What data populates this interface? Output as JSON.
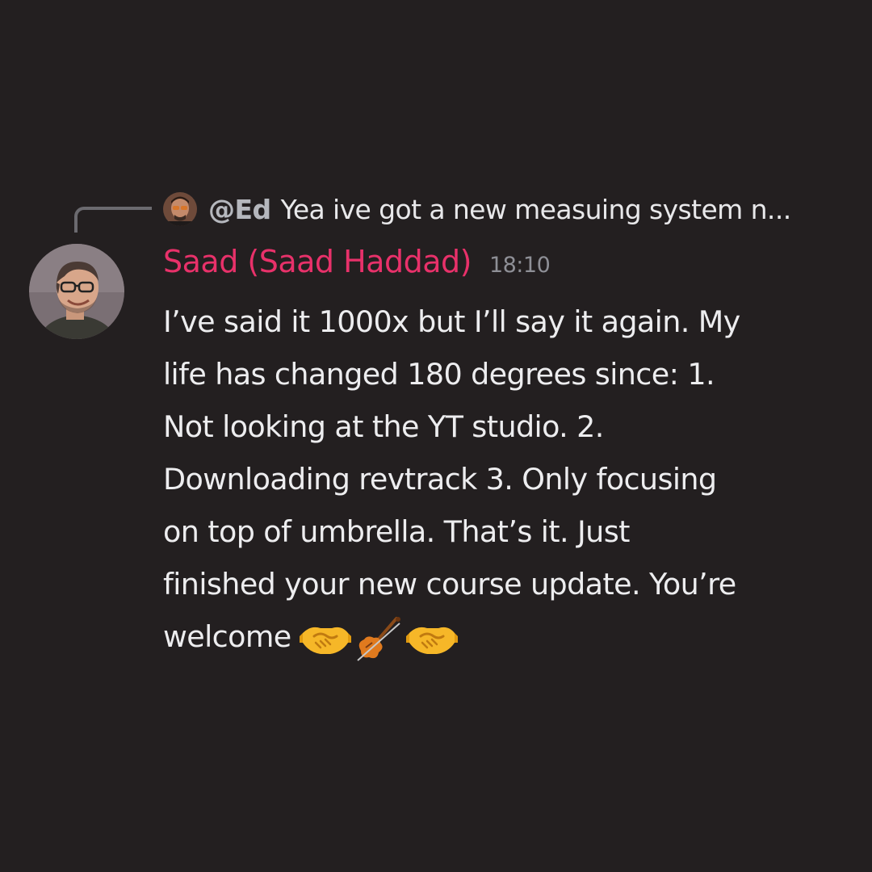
{
  "reply": {
    "author": "@Ed",
    "preview": "Yea ive got a new measuing system n..."
  },
  "message": {
    "username": "Saad (Saad Haddad)",
    "timestamp": "18:10",
    "lines": [
      "I’ve said it 1000x but I’ll say it again. My",
      "life has changed 180 degrees since: 1.",
      "Not looking at the YT studio. 2.",
      "Downloading revtrack 3. Only focusing",
      "on top of umbrella. That’s it. Just",
      "finished your new course update. You’re",
      "welcome"
    ],
    "emojis": [
      "handshake-icon",
      "violin-icon",
      "handshake-icon"
    ]
  },
  "colors": {
    "background": "#231f20",
    "username": "#e8316a",
    "timestamp": "#8e8f96",
    "text": "#ededef",
    "reply_author": "#b5b7bd"
  }
}
